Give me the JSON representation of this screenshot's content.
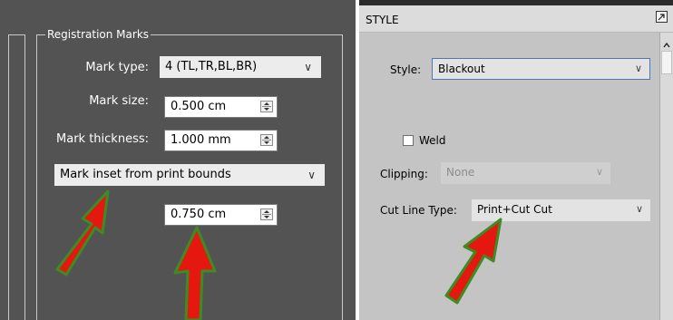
{
  "registration_marks": {
    "group_title": "Registration Marks",
    "mark_type": {
      "label": "Mark type:",
      "value": "4 (TL,TR,BL,BR)"
    },
    "mark_size": {
      "label": "Mark size:",
      "value": "0.500 cm"
    },
    "mark_thickness": {
      "label": "Mark thickness:",
      "value": "1.000 mm"
    },
    "inset_mode": {
      "value": "Mark inset from print bounds"
    },
    "inset_value": {
      "value": "0.750 cm"
    }
  },
  "style_panel": {
    "title": "STYLE",
    "style": {
      "label": "Style:",
      "value": "Blackout"
    },
    "weld": {
      "label": "Weld",
      "checked": false
    },
    "clipping": {
      "label": "Clipping:",
      "value": "None"
    },
    "cut_line_type": {
      "label": "Cut Line Type:",
      "value": "Print+Cut Cut"
    }
  },
  "annotations": {
    "arrow_color": "#e4180e",
    "arrow_outline": "#3c8c23"
  },
  "icons": [
    "chevron-down-icon",
    "spinner-icon",
    "restore-window-icon",
    "scroll-up-icon",
    "annotation-arrow-icon"
  ]
}
